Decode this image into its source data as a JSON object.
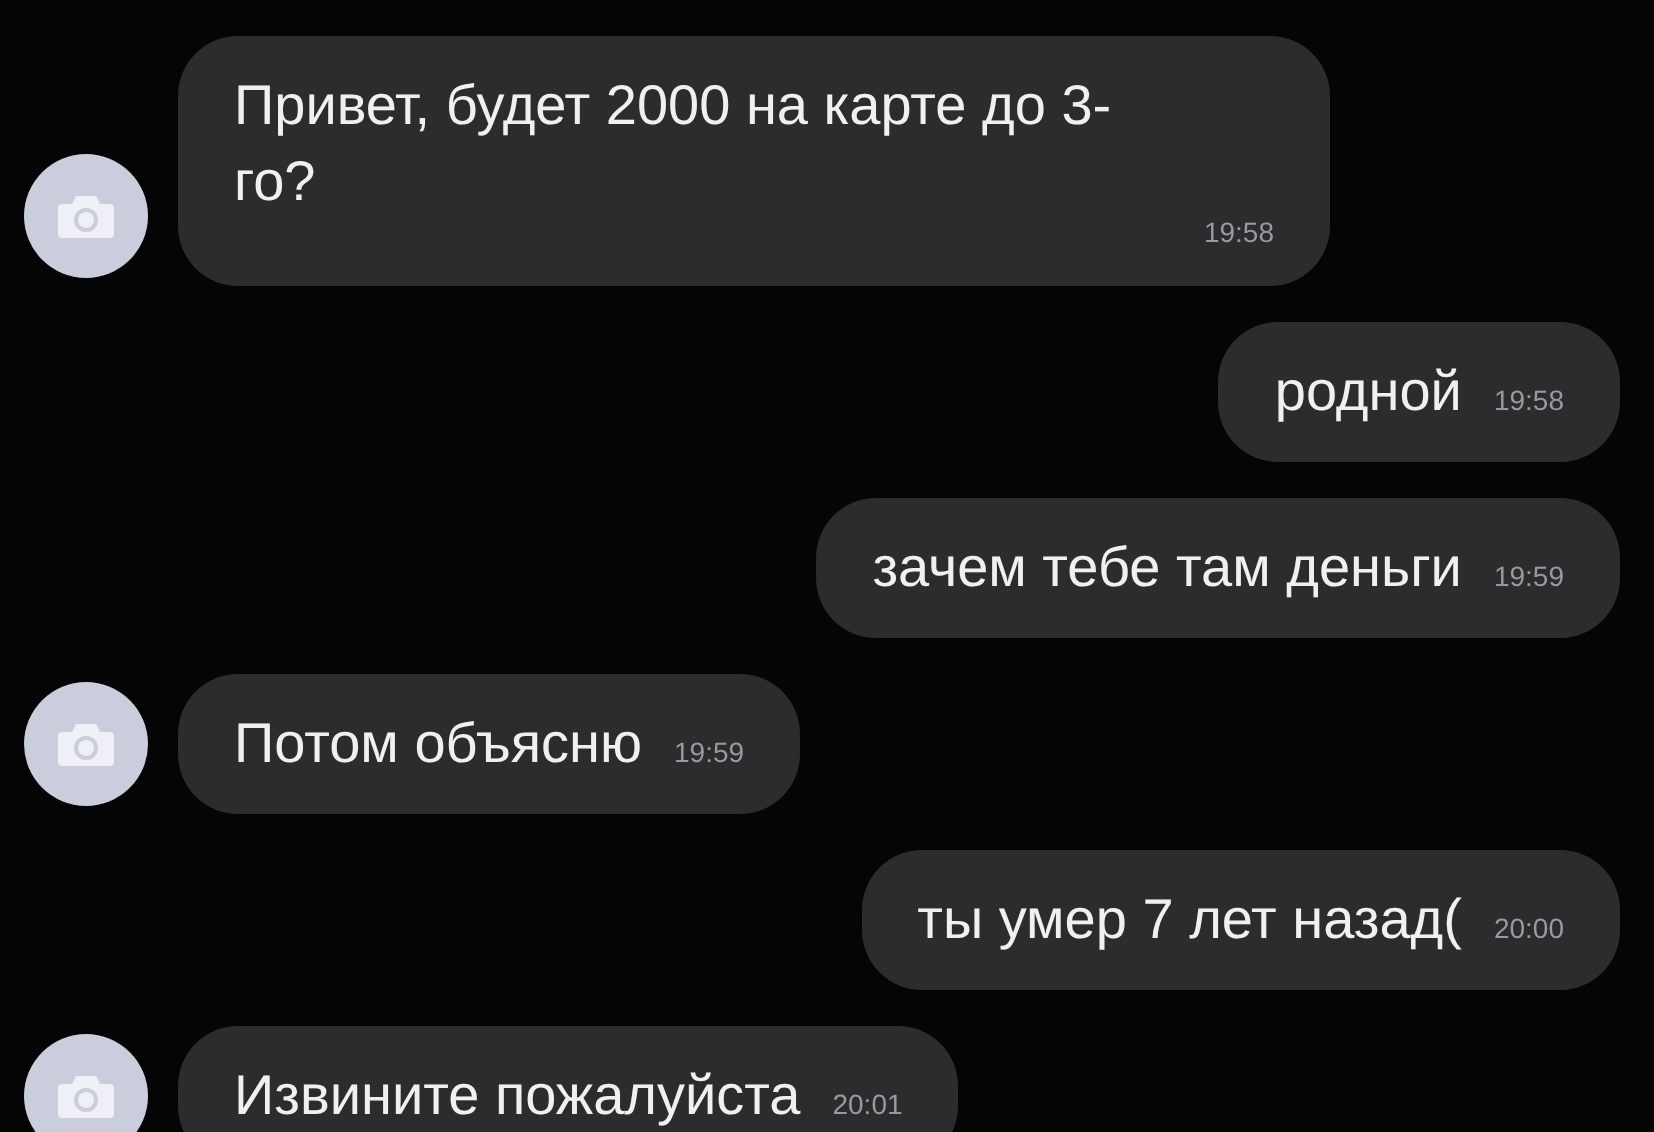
{
  "messages": [
    {
      "kind": "incoming",
      "text": "Привет, будет 2000 на карте до 3-го?",
      "time": "19:58"
    },
    {
      "kind": "outgoing",
      "text": "родной",
      "time": "19:58"
    },
    {
      "kind": "outgoing",
      "text": "зачем тебе там деньги",
      "time": "19:59"
    },
    {
      "kind": "incoming",
      "text": "Потом объясню",
      "time": "19:59"
    },
    {
      "kind": "outgoing",
      "text": "ты умер 7 лет назад(",
      "time": "20:00"
    },
    {
      "kind": "incoming",
      "text": "Извините пожалуйста",
      "time": "20:01"
    }
  ]
}
